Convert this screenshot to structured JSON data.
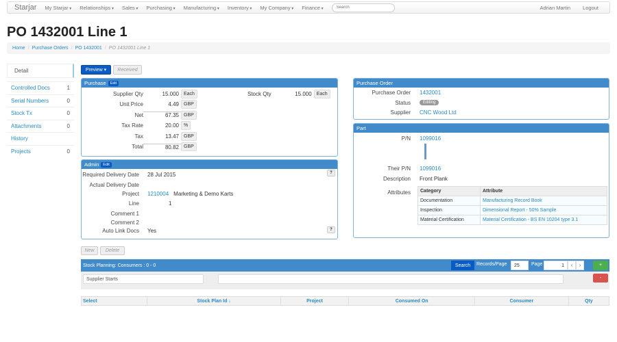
{
  "nav": {
    "brand": "Starjar",
    "menus": [
      "My Starjar",
      "Relationships",
      "Sales",
      "Purchasing",
      "Manufacturing",
      "Inventory",
      "My Company",
      "Finance"
    ],
    "search_placeholder": "Search",
    "user": "Adrian Martin",
    "logout": "Logout"
  },
  "title": "PO 1432001 Line 1",
  "breadcrumb": [
    "Home",
    "Purchase Orders",
    "PO 1432001",
    "PO 1432001 Line 1"
  ],
  "sidebar": {
    "detail": "Detail",
    "items": [
      {
        "label": "Controlled Docs",
        "count": "1"
      },
      {
        "label": "Serial Numbers",
        "count": "0"
      },
      {
        "label": "Stock Tx",
        "count": "0"
      },
      {
        "label": "Attachments",
        "count": "0"
      },
      {
        "label": "History",
        "count": ""
      },
      {
        "label": "Projects",
        "count": "0"
      }
    ]
  },
  "actions": {
    "preview": "Preview",
    "received": "Received",
    "new": "New",
    "delete": "Delete"
  },
  "purchase": {
    "title": "Purchase",
    "edit": "Edit",
    "rows": [
      {
        "label": "Supplier Qty",
        "value": "15.000",
        "unit": "Each"
      },
      {
        "label": "Unit Price",
        "value": "4.49",
        "unit": "GBP"
      },
      {
        "label": "Net",
        "value": "67.35",
        "unit": "GBP"
      },
      {
        "label": "Tax Rate",
        "value": "20.00",
        "unit": "%"
      },
      {
        "label": "Tax",
        "value": "13.47",
        "unit": "GBP"
      },
      {
        "label": "Total",
        "value": "80.82",
        "unit": "GBP"
      }
    ],
    "stock_qty_label": "Stock Qty",
    "stock_qty": "15.000",
    "stock_unit": "Each"
  },
  "admin": {
    "title": "Admin",
    "edit": "Edit",
    "required_label": "Required Delivery Date",
    "required": "28 Jul 2015",
    "actual_label": "Actual Delivery Date",
    "project_label": "Project",
    "project_id": "1210004",
    "project_name": "Marketing & Demo Karts",
    "line_label": "Line",
    "line": "1",
    "comment1_label": "Comment 1",
    "comment2_label": "Comment 2",
    "autolink_label": "Auto Link Docs",
    "autolink": "Yes"
  },
  "po": {
    "title": "Purchase Order",
    "po_label": "Purchase Order",
    "po": "1432001",
    "status_label": "Status",
    "status": "Editing",
    "supplier_label": "Supplier",
    "supplier": "CNC Wood Ltd"
  },
  "part": {
    "title": "Part",
    "pn_label": "P/N",
    "pn": "1099016",
    "their_label": "Their P/N",
    "their": "1099016",
    "desc_label": "Description",
    "desc": "Front Plank",
    "attr_label": "Attributes",
    "attr_headers": [
      "Category",
      "Attribute"
    ],
    "attrs": [
      [
        "Documentation",
        "Manufacturing Record Book"
      ],
      [
        "Inspection",
        "Dimensional Report - 50% Sample"
      ],
      [
        "Material Certification",
        "Material Certification - BS EN 10204 type 3.1"
      ]
    ]
  },
  "stock": {
    "title": "Stock Planning: Consumers : 0 - 0",
    "search": "Search",
    "records_label": "Records/Page",
    "records": "25",
    "page_label": "Page",
    "page": "1",
    "filter_field": "Supplier Starts",
    "columns": [
      "Select",
      "Stock Plan Id ↓",
      "Project",
      "Consumed On",
      "Consumer",
      "Qty"
    ]
  }
}
